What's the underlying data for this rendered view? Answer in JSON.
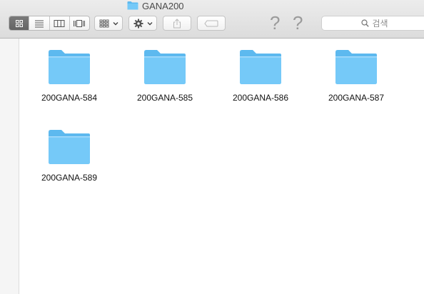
{
  "window": {
    "title": "GANA200"
  },
  "toolbar": {
    "view_modes": [
      {
        "name": "icon-view",
        "active": true
      },
      {
        "name": "list-view",
        "active": false
      },
      {
        "name": "column-view",
        "active": false
      },
      {
        "name": "cover-flow-view",
        "active": false
      }
    ],
    "help_glyph_1": "?",
    "help_glyph_2": "?",
    "search_placeholder": "검색"
  },
  "colors": {
    "folder_body": "#6fc8f8",
    "folder_tab": "#5db9ef",
    "active_segment": "#6b6b6b"
  },
  "icons": {
    "folder": "folder-icon",
    "gear": "gear-icon",
    "share": "share-icon",
    "tag": "tag-icon",
    "search": "search-icon",
    "arrange": "arrange-icon"
  },
  "items": [
    {
      "label": "200GANA-584"
    },
    {
      "label": "200GANA-585"
    },
    {
      "label": "200GANA-586"
    },
    {
      "label": "200GANA-587"
    },
    {
      "label": "200GANA-589"
    }
  ]
}
